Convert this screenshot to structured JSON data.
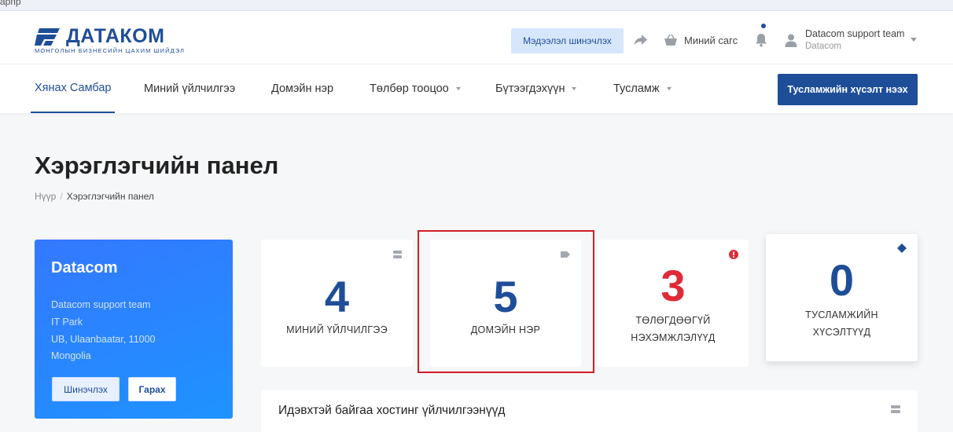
{
  "browser": {
    "strip_text": "арпр"
  },
  "header": {
    "logo_text": "ДАТАКОМ",
    "logo_subtitle": "МОНГОЛЫН БИЗНЕСИЙН ЦАХИМ ШИЙДЭЛ",
    "update_info_label": "Мэдээлэл шинэчлэх",
    "cart_label": "Миний сагс",
    "user_name": "Datacom support team",
    "user_company": "Datacom"
  },
  "nav": {
    "items": [
      {
        "label": "Хянах Самбар",
        "active": true,
        "dropdown": false
      },
      {
        "label": "Миний үйлчилгээ",
        "active": false,
        "dropdown": false
      },
      {
        "label": "Домэйн нэр",
        "active": false,
        "dropdown": false
      },
      {
        "label": "Төлбөр тооцоо",
        "active": false,
        "dropdown": true
      },
      {
        "label": "Бүтээгдэхүүн",
        "active": false,
        "dropdown": true
      },
      {
        "label": "Тусламж",
        "active": false,
        "dropdown": true
      }
    ],
    "request_button": "Тусламжийн хүсэлт нээх"
  },
  "page": {
    "title": "Хэрэглэгчийн панел",
    "breadcrumb": [
      "Нүүр",
      "Хэрэглэгчийн панел"
    ]
  },
  "profile": {
    "company": "Datacom",
    "lines": [
      "Datacom support team",
      "IT Park",
      "UB, Ulaanbaatar, 11000",
      "Mongolia"
    ],
    "update_button": "Шинэчлэх",
    "logout_button": "Гарах"
  },
  "stats": [
    {
      "value": "4",
      "label_line1": "МИНИЙ ҮЙЛЧИЛГЭЭ",
      "label_line2": "",
      "icon": "server-icon",
      "color": "#1f4e98"
    },
    {
      "value": "5",
      "label_line1": "ДОМЭЙН НЭР",
      "label_line2": "",
      "icon": "tag-icon",
      "color": "#1f4e98"
    },
    {
      "value": "3",
      "label_line1": "ТӨЛӨГДӨӨГҮЙ",
      "label_line2": "НЭХЭМЖЛЭЛҮҮД",
      "icon": "alert-icon",
      "color": "#e02a37"
    },
    {
      "value": "0",
      "label_line1": "ТУСЛАМЖИЙН",
      "label_line2": "ХҮСЭЛТҮҮД",
      "icon": "ticket-icon",
      "color": "#1f4e98"
    }
  ],
  "hosting": {
    "title": "Идэвхтэй байгаа хостинг үйлчилгээнүүд"
  },
  "colors": {
    "brand": "#1f4e98",
    "danger": "#e02a37",
    "highlight": "#d21e26",
    "card_blue": "#2b86ff"
  }
}
